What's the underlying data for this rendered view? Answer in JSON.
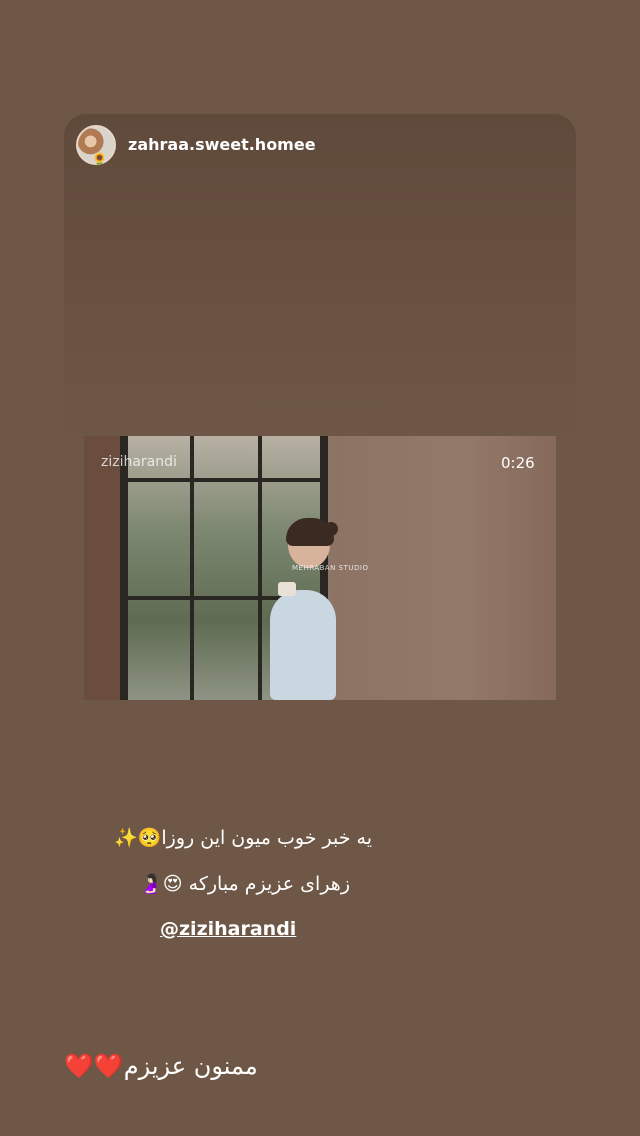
{
  "story": {
    "username": "zahraa.sweet.homee",
    "avatar_flower": "🌻"
  },
  "media": {
    "watermark_user": "ziziharandi",
    "duration": "0:26",
    "studio_watermark": "MEHRABAN STUDIO"
  },
  "caption": {
    "line1": "یه خبر خوب میون این روزا🥺✨",
    "line2": "زهرای عزیزم مبارکه 😍🤰🏻",
    "mention": "@ziziharandi",
    "thanks": "ممنون عزیزم❤️❤️"
  }
}
